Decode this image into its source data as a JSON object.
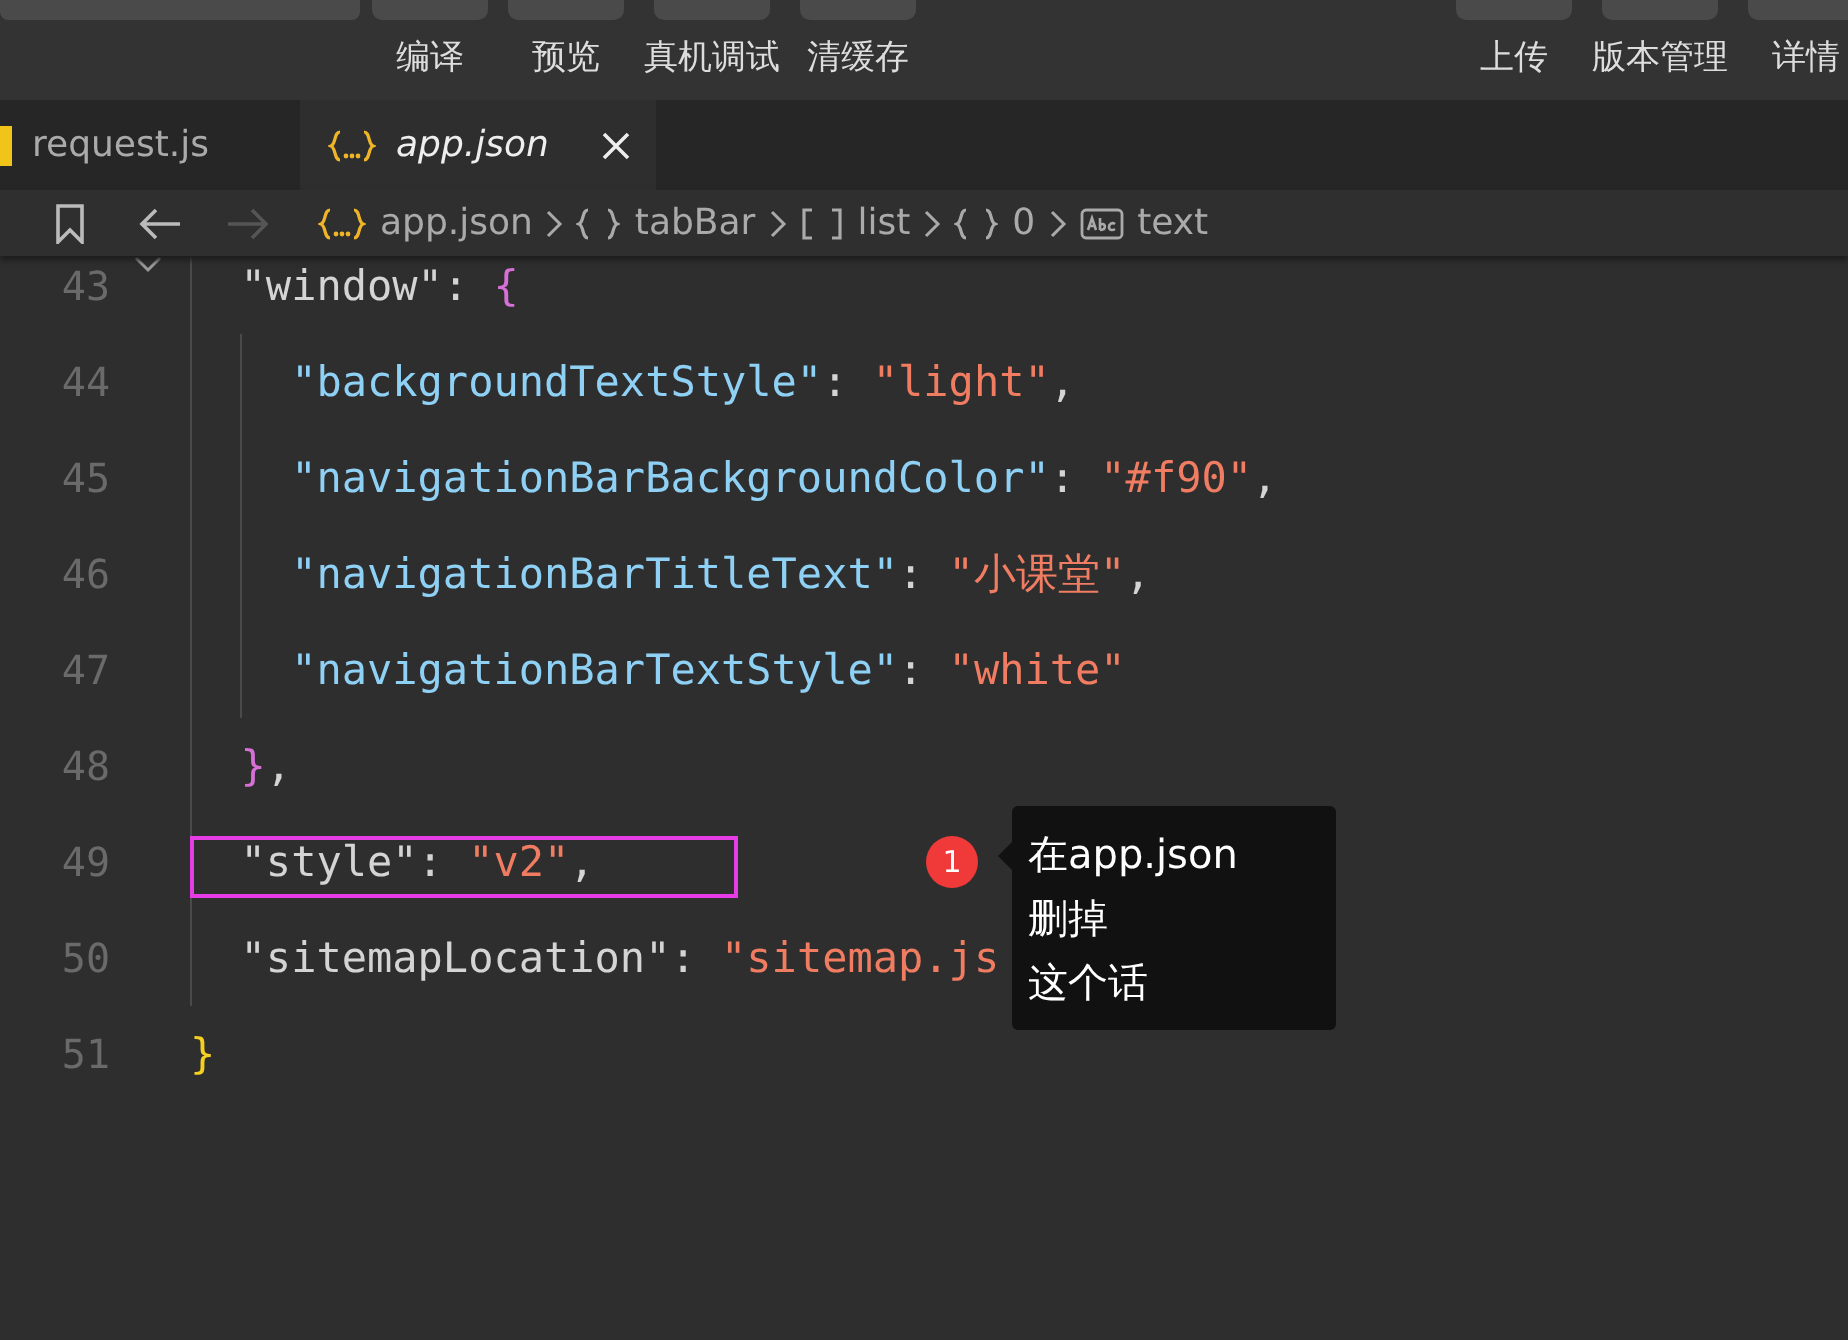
{
  "toolbar": {
    "left": [
      {
        "label": "编译"
      },
      {
        "label": "预览"
      },
      {
        "label": "真机调试"
      },
      {
        "label": "清缓存"
      }
    ],
    "right": [
      {
        "label": "上传"
      },
      {
        "label": "版本管理"
      },
      {
        "label": "详情"
      }
    ]
  },
  "tabs": [
    {
      "label": "request.js",
      "kind": "js",
      "selected": false
    },
    {
      "label": "app.json",
      "kind": "json",
      "selected": true
    }
  ],
  "breadcrumb": [
    {
      "kind": "file",
      "label": "app.json"
    },
    {
      "kind": "object",
      "label": "tabBar"
    },
    {
      "kind": "array",
      "label": "list"
    },
    {
      "kind": "object",
      "label": "0"
    },
    {
      "kind": "text",
      "label": "text"
    }
  ],
  "body": [
    {
      "number": "43",
      "foldable": true,
      "tokens": [
        {
          "text": "\"window\"",
          "kind": "key"
        },
        {
          "text": ": ",
          "kind": "punct"
        },
        {
          "text": "{",
          "kind": "brace-pink"
        }
      ],
      "children": [
        {
          "number": "44",
          "tokens": [
            {
              "text": "\"backgroundTextStyle\"",
              "kind": "prop"
            },
            {
              "text": ": ",
              "kind": "punct"
            },
            {
              "text": "\"light\"",
              "kind": "string"
            },
            {
              "text": ",",
              "kind": "punct"
            }
          ]
        },
        {
          "number": "45",
          "tokens": [
            {
              "text": "\"navigationBarBackgroundColor\"",
              "kind": "prop"
            },
            {
              "text": ": ",
              "kind": "punct"
            },
            {
              "text": "\"#f90\"",
              "kind": "string"
            },
            {
              "text": ",",
              "kind": "punct"
            }
          ]
        },
        {
          "number": "46",
          "tokens": [
            {
              "text": "\"navigationBarTitleText\"",
              "kind": "prop"
            },
            {
              "text": ": ",
              "kind": "punct"
            },
            {
              "text": "\"小课堂\"",
              "kind": "string"
            },
            {
              "text": ",",
              "kind": "punct"
            }
          ]
        },
        {
          "number": "47",
          "tokens": [
            {
              "text": "\"navigationBarTextStyle\"",
              "kind": "prop"
            },
            {
              "text": ": ",
              "kind": "punct"
            },
            {
              "text": "\"white\"",
              "kind": "string"
            }
          ]
        }
      ]
    },
    {
      "number": "48",
      "tokens": [
        {
          "text": "}",
          "kind": "brace-pink"
        },
        {
          "text": ",",
          "kind": "punct"
        }
      ]
    },
    {
      "number": "49",
      "highlighted": true,
      "tokens": [
        {
          "text": "\"style\"",
          "kind": "key"
        },
        {
          "text": ": ",
          "kind": "punct"
        },
        {
          "text": "\"v2\"",
          "kind": "string"
        },
        {
          "text": ",",
          "kind": "punct"
        }
      ],
      "note": {
        "badge": "1",
        "lines": [
          "在app.json",
          "删掉",
          "这个话"
        ]
      }
    },
    {
      "number": "50",
      "tokens": [
        {
          "text": "\"sitemapLocation\"",
          "kind": "key"
        },
        {
          "text": ": ",
          "kind": "punct"
        },
        {
          "text": "\"sitemap.js",
          "kind": "string"
        }
      ]
    }
  ],
  "closing": {
    "number": "51",
    "tokens": [
      {
        "text": "}",
        "kind": "brace-gold"
      }
    ]
  }
}
